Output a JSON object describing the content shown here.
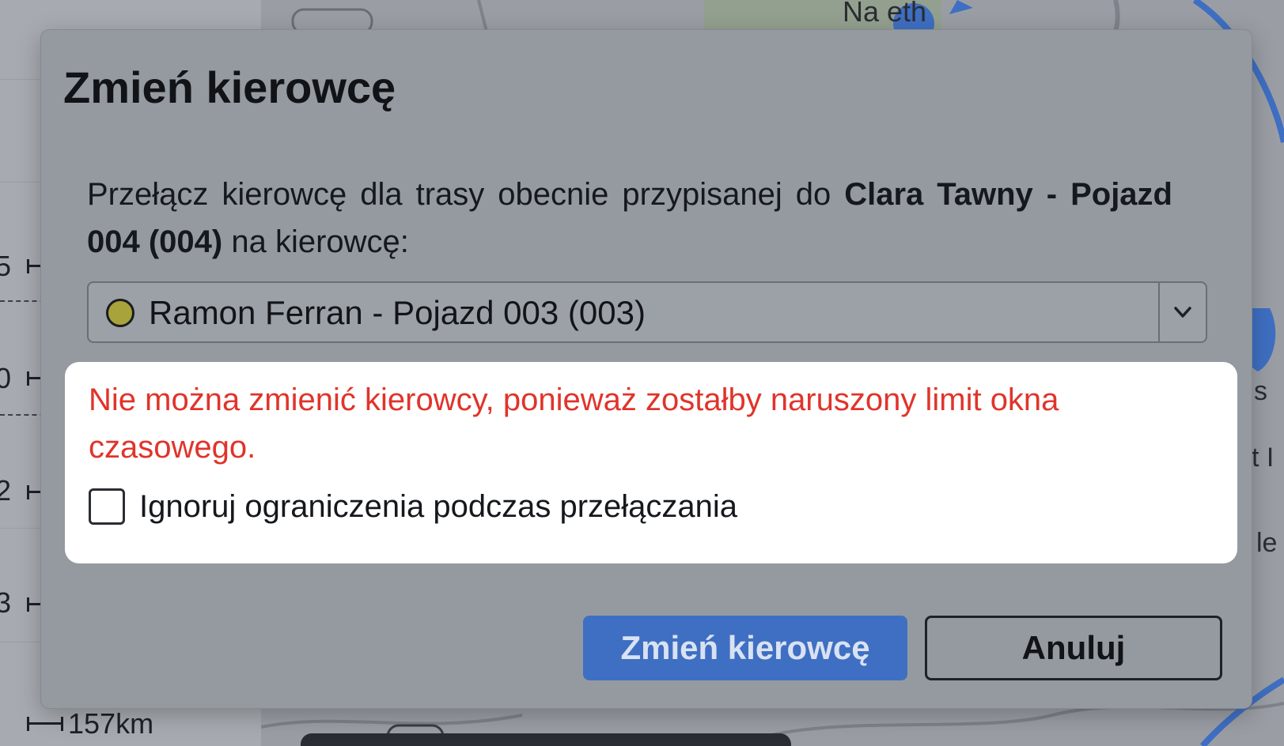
{
  "modal": {
    "title": "Zmień kierowcę",
    "description_prefix": "Przełącz kierowcę dla trasy obecnie przypisanej do ",
    "current_driver": "Clara Tawny - Pojazd 004 (004)",
    "description_suffix": " na kierowcę:",
    "driver_select": {
      "value": "Ramon Ferran - Pojazd 003 (003)",
      "status_color": "#a8a33a"
    },
    "warning": {
      "message": "Nie można zmienić kierowcy, ponieważ zostałby naruszony limit okna czasowego.",
      "color": "#e0342b"
    },
    "ignore_constraints": {
      "label": "Ignoruj ograniczenia podczas przełączania",
      "checked": false
    },
    "confirm_label": "Zmień kierowcę",
    "cancel_label": "Anuluj",
    "accent_color": "#3f6fc2"
  },
  "background": {
    "distance": "157km",
    "map_label_town": "Na   eth"
  }
}
